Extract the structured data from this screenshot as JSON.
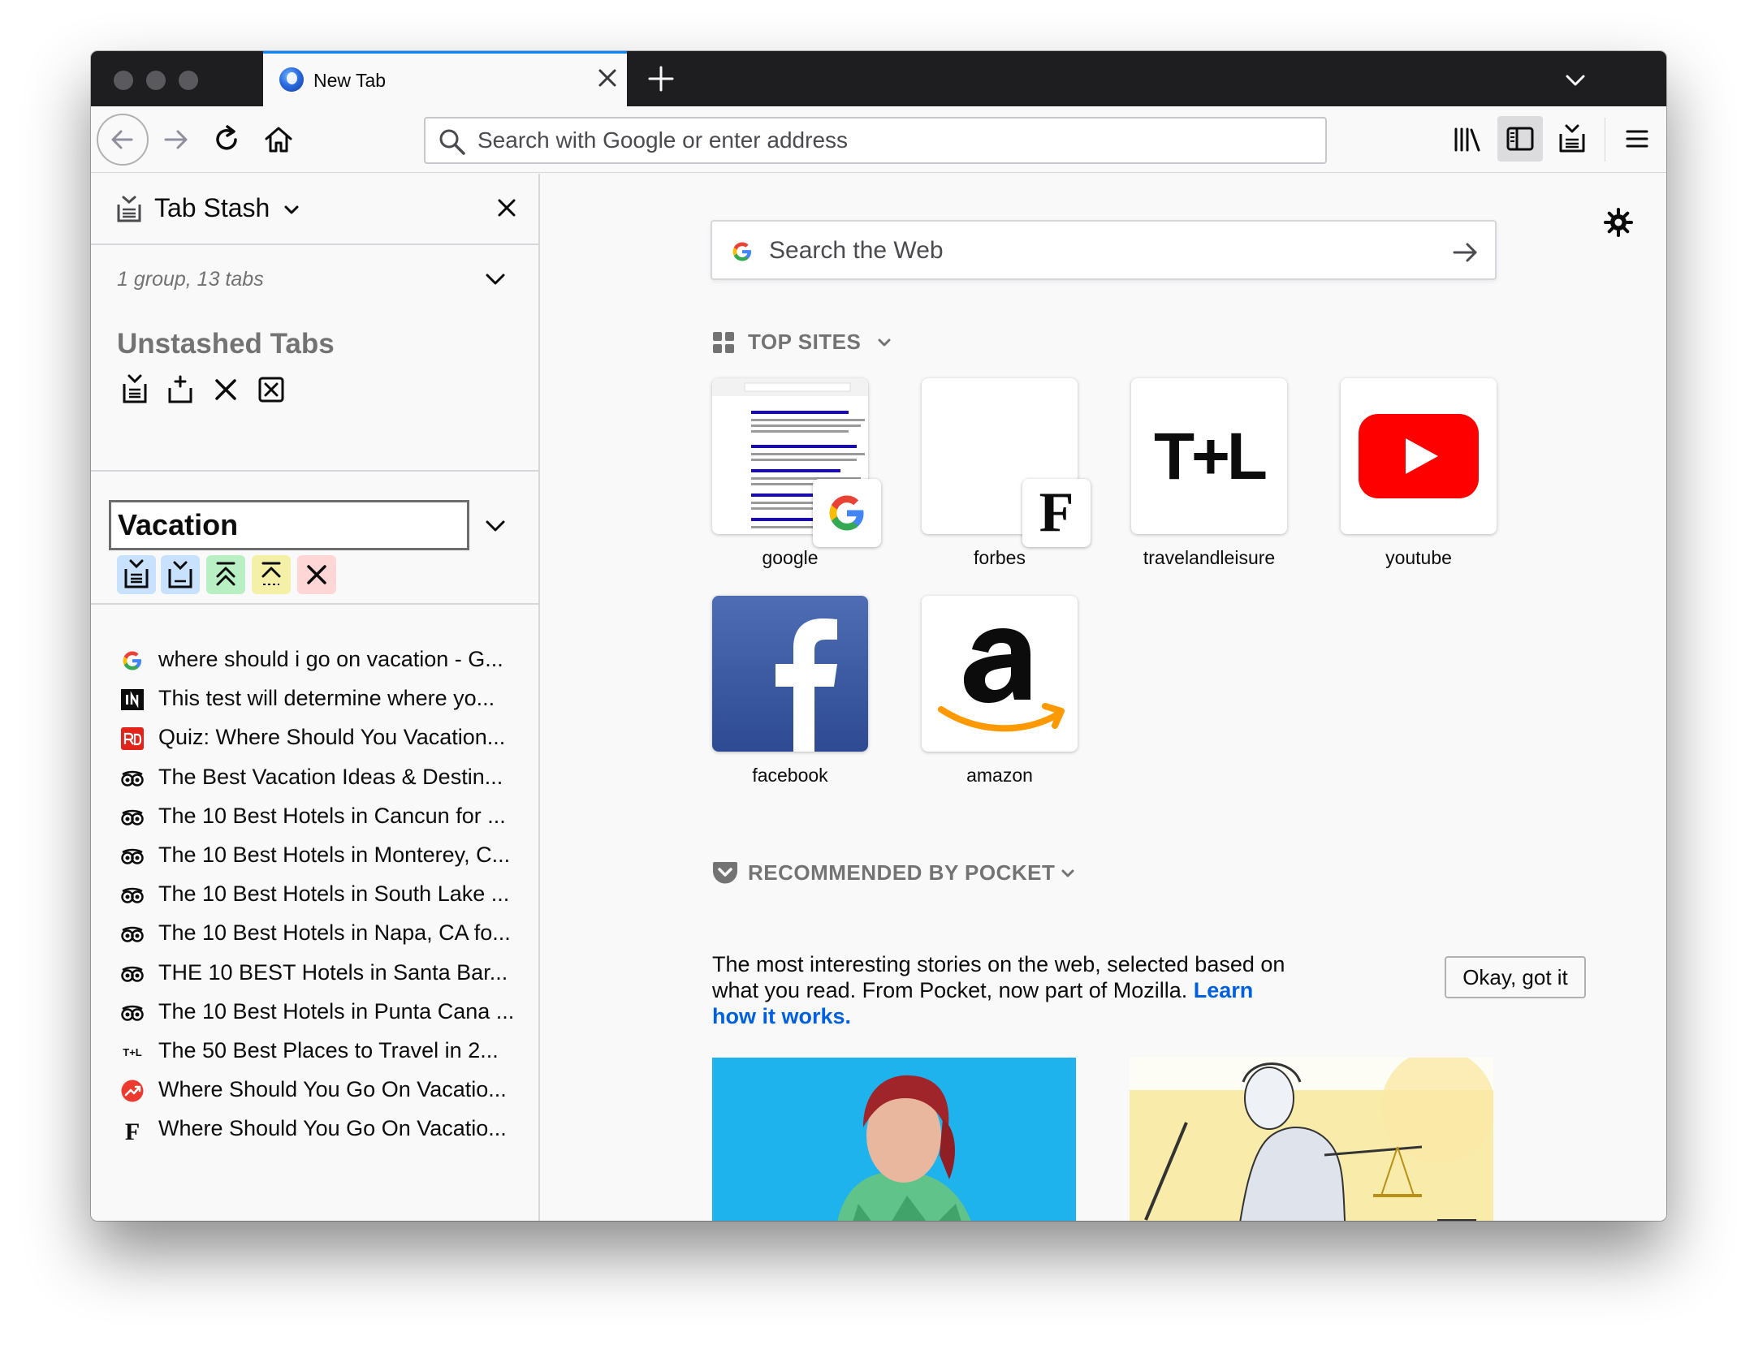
{
  "browser": {
    "tab_title": "New Tab",
    "url_placeholder": "Search with Google or enter address"
  },
  "sidebar": {
    "title": "Tab Stash",
    "summary": "1 group, 13 tabs",
    "unstashed_title": "Unstashed Tabs",
    "group_name": "Vacation",
    "tabs": [
      {
        "title": "where should i go on vacation - G...",
        "icon": "google-icon"
      },
      {
        "title": "This test will determine where yo...",
        "icon": "insider-icon"
      },
      {
        "title": "Quiz: Where Should You Vacation...",
        "icon": "readers-digest-icon"
      },
      {
        "title": "The Best Vacation Ideas & Destin...",
        "icon": "tripadvisor-icon"
      },
      {
        "title": "The 10 Best Hotels in Cancun for ...",
        "icon": "tripadvisor-icon"
      },
      {
        "title": "The 10 Best Hotels in Monterey, C...",
        "icon": "tripadvisor-icon"
      },
      {
        "title": "The 10 Best Hotels in South Lake ...",
        "icon": "tripadvisor-icon"
      },
      {
        "title": "The 10 Best Hotels in Napa, CA fo...",
        "icon": "tripadvisor-icon"
      },
      {
        "title": "THE 10 BEST Hotels in Santa Bar...",
        "icon": "tripadvisor-icon"
      },
      {
        "title": "The 10 Best Hotels in Punta Cana ...",
        "icon": "tripadvisor-icon"
      },
      {
        "title": "The 50 Best Places to Travel in 2...",
        "icon": "tl-icon"
      },
      {
        "title": "Where Should You Go On Vacatio...",
        "icon": "trending-icon"
      },
      {
        "title": "Where Should You Go On Vacatio...",
        "icon": "forbes-icon"
      }
    ]
  },
  "newtab": {
    "search_placeholder": "Search the Web",
    "top_sites_title": "TOP SITES",
    "top_sites": [
      {
        "label": "google"
      },
      {
        "label": "forbes"
      },
      {
        "label": "travelandleisure"
      },
      {
        "label": "youtube"
      },
      {
        "label": "facebook"
      },
      {
        "label": "amazon"
      }
    ],
    "tl_logo": "T+L",
    "forbes_logo": "F",
    "pocket_title": "RECOMMENDED BY POCKET",
    "pocket_text": "The most interesting stories on the web, selected based on what you read. From Pocket, now part of Mozilla.",
    "pocket_link": "Learn how it works.",
    "okay_button": "Okay, got it"
  },
  "colors": {
    "accent": "#0a84ff",
    "link": "#0060df",
    "youtube_red": "#ff0000",
    "facebook_blue": "#3b5998",
    "amazon_orange": "#ff9900"
  }
}
